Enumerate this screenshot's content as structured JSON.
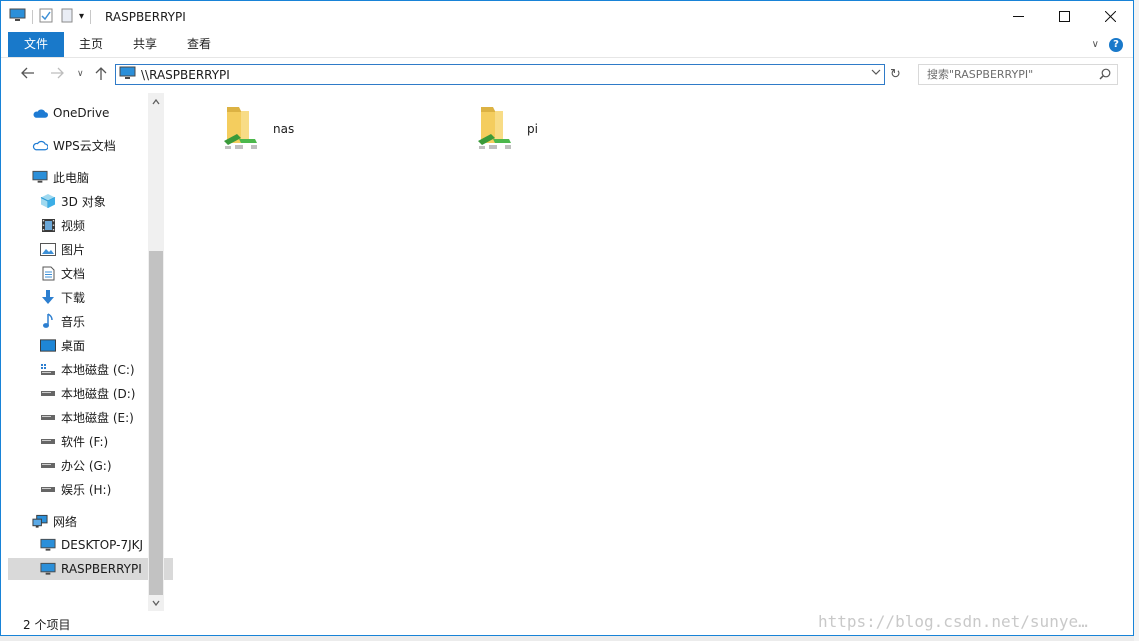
{
  "window": {
    "title": "RASPBERRYPI"
  },
  "ribbon": {
    "tabs": [
      {
        "label": "文件"
      },
      {
        "label": "主页"
      },
      {
        "label": "共享"
      },
      {
        "label": "查看"
      }
    ]
  },
  "address": {
    "path": "\\\\RASPBERRYPI"
  },
  "search": {
    "placeholder": "搜索\"RASPBERRYPI\""
  },
  "sidebar": {
    "items": [
      {
        "label": "OneDrive",
        "icon": "onedrive-cloud-icon"
      },
      {
        "label": "WPS云文档",
        "icon": "wps-cloud-icon"
      },
      {
        "label": "此电脑",
        "icon": "computer-icon"
      },
      {
        "label": "3D 对象",
        "icon": "3d-objects-icon"
      },
      {
        "label": "视频",
        "icon": "video-icon"
      },
      {
        "label": "图片",
        "icon": "pictures-icon"
      },
      {
        "label": "文档",
        "icon": "documents-icon"
      },
      {
        "label": "下载",
        "icon": "download-icon"
      },
      {
        "label": "音乐",
        "icon": "music-icon"
      },
      {
        "label": "桌面",
        "icon": "desktop-icon"
      },
      {
        "label": "本地磁盘 (C:)",
        "icon": "system-drive-icon"
      },
      {
        "label": "本地磁盘 (D:)",
        "icon": "drive-icon"
      },
      {
        "label": "本地磁盘 (E:)",
        "icon": "drive-icon"
      },
      {
        "label": "软件 (F:)",
        "icon": "drive-icon"
      },
      {
        "label": "办公 (G:)",
        "icon": "drive-icon"
      },
      {
        "label": "娱乐 (H:)",
        "icon": "drive-icon"
      },
      {
        "label": "网络",
        "icon": "network-icon"
      },
      {
        "label": "DESKTOP-7JKJ",
        "icon": "computer-icon"
      },
      {
        "label": "RASPBERRYPI",
        "icon": "computer-icon",
        "selected": true
      }
    ]
  },
  "content": {
    "items": [
      {
        "label": "nas",
        "icon": "shared-folder-icon"
      },
      {
        "label": "pi",
        "icon": "shared-folder-icon"
      }
    ]
  },
  "status": {
    "count": "2 个项目"
  },
  "watermark": {
    "text": "https://blog.csdn.net/sunye…"
  },
  "colors": {
    "accent": "#1979ca",
    "selection": "#d9d9d9"
  }
}
